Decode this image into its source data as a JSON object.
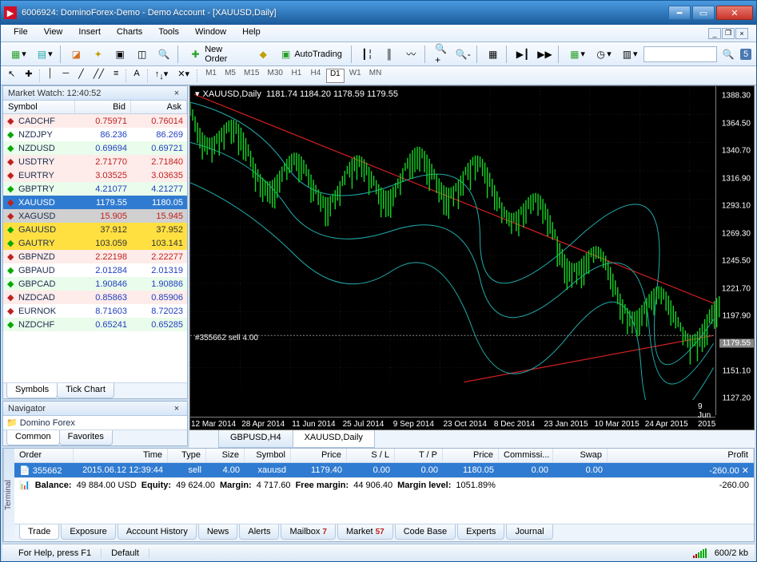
{
  "window": {
    "title": "6006924: DominoForex-Demo - Demo Account - [XAUUSD,Daily]"
  },
  "menu": {
    "items": [
      "File",
      "View",
      "Insert",
      "Charts",
      "Tools",
      "Window",
      "Help"
    ]
  },
  "toolbar": {
    "new_order": "New Order",
    "auto_trading": "AutoTrading",
    "search_badge": "5"
  },
  "timeframes": [
    "M1",
    "M5",
    "M15",
    "M30",
    "H1",
    "H4",
    "D1",
    "W1",
    "MN"
  ],
  "timeframe_active": "D1",
  "market_watch": {
    "title": "Market Watch: 12:40:52",
    "headers": {
      "symbol": "Symbol",
      "bid": "Bid",
      "ask": "Ask"
    },
    "rows": [
      {
        "dir": "down",
        "sym": "CADCHF",
        "bid": "0.75971",
        "ask": "0.76014",
        "bc": "#c02020",
        "ac": "#c02020",
        "bg": "#fdecea"
      },
      {
        "dir": "up",
        "sym": "NZDJPY",
        "bid": "86.236",
        "ask": "86.269",
        "bc": "#2040c0",
        "ac": "#2040c0",
        "bg": "#fff"
      },
      {
        "dir": "up",
        "sym": "NZDUSD",
        "bid": "0.69694",
        "ask": "0.69721",
        "bc": "#2040c0",
        "ac": "#2040c0",
        "bg": "#eafceb"
      },
      {
        "dir": "down",
        "sym": "USDTRY",
        "bid": "2.71770",
        "ask": "2.71840",
        "bc": "#c02020",
        "ac": "#c02020",
        "bg": "#fdecea"
      },
      {
        "dir": "down",
        "sym": "EURTRY",
        "bid": "3.03525",
        "ask": "3.03635",
        "bc": "#c02020",
        "ac": "#c02020",
        "bg": "#fdecea"
      },
      {
        "dir": "up",
        "sym": "GBPTRY",
        "bid": "4.21077",
        "ask": "4.21277",
        "bc": "#2040c0",
        "ac": "#2040c0",
        "bg": "#eafceb"
      },
      {
        "dir": "down",
        "sym": "XAUUSD",
        "bid": "1179.55",
        "ask": "1180.05",
        "bc": "#fff",
        "ac": "#fff",
        "bg": "#2f7bd1",
        "sel": true
      },
      {
        "dir": "down",
        "sym": "XAGUSD",
        "bid": "15.905",
        "ask": "15.945",
        "bc": "#c02020",
        "ac": "#c02020",
        "bg": "#d0d0d0"
      },
      {
        "dir": "up",
        "sym": "GAUUSD",
        "bid": "37.912",
        "ask": "37.952",
        "bc": "#333",
        "ac": "#333",
        "bg": "#ffe040"
      },
      {
        "dir": "up",
        "sym": "GAUTRY",
        "bid": "103.059",
        "ask": "103.141",
        "bc": "#333",
        "ac": "#333",
        "bg": "#ffe040"
      },
      {
        "dir": "down",
        "sym": "GBPNZD",
        "bid": "2.22198",
        "ask": "2.22277",
        "bc": "#c02020",
        "ac": "#c02020",
        "bg": "#fdecea"
      },
      {
        "dir": "up",
        "sym": "GBPAUD",
        "bid": "2.01284",
        "ask": "2.01319",
        "bc": "#2040c0",
        "ac": "#2040c0",
        "bg": "#fff"
      },
      {
        "dir": "up",
        "sym": "GBPCAD",
        "bid": "1.90846",
        "ask": "1.90886",
        "bc": "#2040c0",
        "ac": "#2040c0",
        "bg": "#eafceb"
      },
      {
        "dir": "down",
        "sym": "NZDCAD",
        "bid": "0.85863",
        "ask": "0.85906",
        "bc": "#2040c0",
        "ac": "#2040c0",
        "bg": "#fdecea"
      },
      {
        "dir": "down",
        "sym": "EURNOK",
        "bid": "8.71603",
        "ask": "8.72023",
        "bc": "#2040c0",
        "ac": "#2040c0",
        "bg": "#fff"
      },
      {
        "dir": "up",
        "sym": "NZDCHF",
        "bid": "0.65241",
        "ask": "0.65285",
        "bc": "#2040c0",
        "ac": "#2040c0",
        "bg": "#eafceb"
      }
    ],
    "tabs": {
      "symbols": "Symbols",
      "tick": "Tick Chart"
    }
  },
  "navigator": {
    "title": "Navigator",
    "root": "Domino Forex",
    "tabs": {
      "common": "Common",
      "favorites": "Favorites"
    }
  },
  "chart": {
    "label_prefix": "XAUUSD,Daily",
    "ohlc": "1181.74 1184.20 1178.59 1179.55",
    "trade_annotation": "#355662 sell 4.00",
    "tabs": [
      {
        "label": "GBPUSD,H4",
        "active": false
      },
      {
        "label": "XAUUSD,Daily",
        "active": true
      }
    ],
    "ylabels": [
      "1388.30",
      "1364.50",
      "1340.70",
      "1316.90",
      "1293.10",
      "1269.30",
      "1245.50",
      "1221.70",
      "1197.90",
      "1179.55",
      "1151.10",
      "1127.20"
    ],
    "current_price": "1179.55",
    "xlabels": [
      "12 Mar 2014",
      "28 Apr 2014",
      "11 Jun 2014",
      "25 Jul 2014",
      "9 Sep 2014",
      "23 Oct 2014",
      "8 Dec 2014",
      "23 Jan 2015",
      "10 Mar 2015",
      "24 Apr 2015",
      "9 Jun 2015"
    ]
  },
  "terminal": {
    "side": "Terminal",
    "headers": {
      "order": "Order",
      "time": "Time",
      "type": "Type",
      "size": "Size",
      "symbol": "Symbol",
      "price1": "Price",
      "sl": "S / L",
      "tp": "T / P",
      "price2": "Price",
      "commission": "Commissi...",
      "swap": "Swap",
      "profit": "Profit"
    },
    "row": {
      "order": "355662",
      "time": "2015.06.12 12:39:44",
      "type": "sell",
      "size": "4.00",
      "symbol": "xauusd",
      "price1": "1179.40",
      "sl": "0.00",
      "tp": "0.00",
      "price2": "1180.05",
      "commission": "0.00",
      "swap": "0.00",
      "profit": "-260.00"
    },
    "balance_line": {
      "balance_label": "Balance:",
      "balance": "49 884.00 USD",
      "equity_label": "Equity:",
      "equity": "49 624.00",
      "margin_label": "Margin:",
      "margin": "4 717.60",
      "free_margin_label": "Free margin:",
      "free_margin": "44 906.40",
      "margin_level_label": "Margin level:",
      "margin_level": "1051.89%",
      "profit": "-260.00"
    },
    "tabs": {
      "trade": "Trade",
      "exposure": "Exposure",
      "history": "Account History",
      "news": "News",
      "alerts": "Alerts",
      "mailbox": "Mailbox",
      "mailbox_badge": "7",
      "market": "Market",
      "market_badge": "57",
      "codebase": "Code Base",
      "experts": "Experts",
      "journal": "Journal"
    }
  },
  "status": {
    "help": "For Help, press F1",
    "default": "Default",
    "kb": "600/2 kb"
  }
}
